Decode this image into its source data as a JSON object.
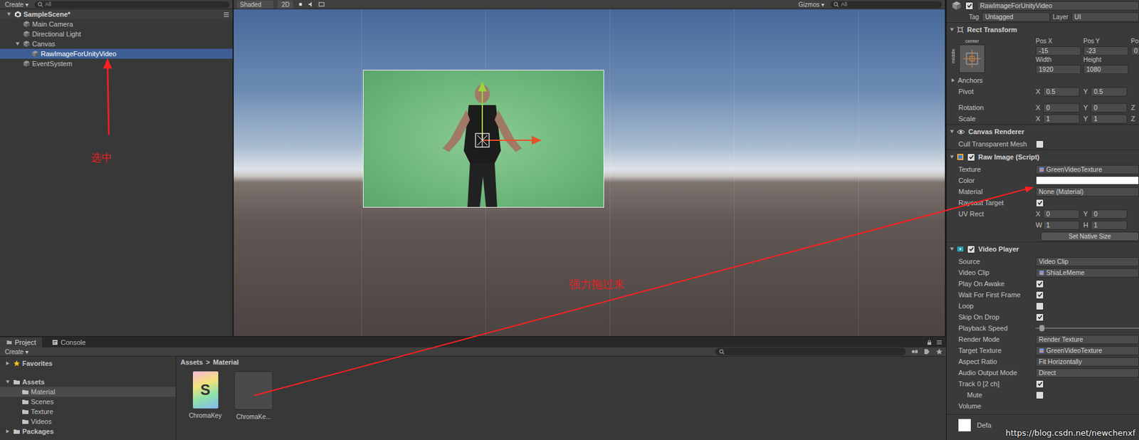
{
  "toolbars": {
    "hierarchy_create": "Create ▾",
    "hierarchy_search": "All",
    "scene_shading": "Shaded",
    "scene_mode": "2D",
    "gizmos": "Gizmos ▾",
    "scene_search": "All"
  },
  "hierarchy": {
    "scene": "SampleScene*",
    "scene_expanded": true,
    "items": [
      {
        "label": "Main Camera",
        "depth": 1,
        "has_children": false,
        "expanded": false,
        "selected": false
      },
      {
        "label": "Directional Light",
        "depth": 1,
        "has_children": false,
        "expanded": false,
        "selected": false
      },
      {
        "label": "Canvas",
        "depth": 1,
        "has_children": true,
        "expanded": true,
        "selected": false
      },
      {
        "label": "RawImageForUnityVideo",
        "depth": 2,
        "has_children": false,
        "expanded": false,
        "selected": true
      },
      {
        "label": "EventSystem",
        "depth": 1,
        "has_children": false,
        "expanded": false,
        "selected": false
      }
    ]
  },
  "inspector": {
    "object_name": "RawImageForUnityVideo",
    "active": true,
    "tag_label": "Tag",
    "tag": "Untagged",
    "layer_label": "Layer",
    "layer": "UI",
    "rect_transform": {
      "title": "Rect Transform",
      "expanded": true,
      "anchor_h": "center",
      "anchor_v": "middle",
      "pos_labels": [
        "Pos X",
        "Pos Y",
        "Po"
      ],
      "pos_values": [
        "-15",
        "-23",
        "0"
      ],
      "size_labels": [
        "Width",
        "Height"
      ],
      "size_values": [
        "1920",
        "1080"
      ],
      "anchors_label": "Anchors",
      "anchors_expanded": false,
      "vectors": [
        {
          "label": "Pivot",
          "fields": [
            {
              "axis": "X",
              "value": "0.5"
            },
            {
              "axis": "Y",
              "value": "0.5"
            }
          ]
        },
        {
          "label": "Rotation",
          "fields": [
            {
              "axis": "X",
              "value": "0"
            },
            {
              "axis": "Y",
              "value": "0"
            },
            {
              "axis": "Z",
              "value": ""
            }
          ]
        },
        {
          "label": "Scale",
          "fields": [
            {
              "axis": "X",
              "value": "1"
            },
            {
              "axis": "Y",
              "value": "1"
            },
            {
              "axis": "Z",
              "value": ""
            }
          ]
        }
      ]
    },
    "components": [
      {
        "title": "Canvas Renderer",
        "kind": "plain",
        "expanded": true,
        "enabled": true,
        "rows": [
          {
            "kind": "check",
            "label": "Cull Transparent Mesh",
            "checked": false
          }
        ]
      },
      {
        "title": "Raw Image (Script)",
        "kind": "toggle",
        "expanded": true,
        "enabled": true,
        "rows": [
          {
            "kind": "object",
            "label": "Texture",
            "value": "GreenVideoTexture"
          },
          {
            "kind": "color",
            "label": "Color",
            "color": "#ffffff"
          },
          {
            "kind": "text",
            "label": "Material",
            "value": "None (Material)"
          },
          {
            "kind": "check",
            "label": "Raycast Target",
            "checked": true
          },
          {
            "kind": "vector",
            "label": "UV Rect",
            "fields": [
              {
                "axis": "X",
                "value": "0"
              },
              {
                "axis": "Y",
                "value": "0"
              }
            ]
          },
          {
            "kind": "vector",
            "label": "",
            "fields": [
              {
                "axis": "W",
                "value": "1"
              },
              {
                "axis": "H",
                "value": "1"
              }
            ]
          },
          {
            "kind": "button",
            "label": "Set Native Size"
          }
        ]
      },
      {
        "title": "Video Player",
        "kind": "toggle",
        "expanded": true,
        "enabled": true,
        "rows": [
          {
            "kind": "dropdown",
            "label": "Source",
            "value": "Video Clip"
          },
          {
            "kind": "object",
            "label": "Video Clip",
            "value": "ShiaLeMeme"
          },
          {
            "kind": "check",
            "label": "Play On Awake",
            "checked": true
          },
          {
            "kind": "check",
            "label": "Wait For First Frame",
            "checked": true
          },
          {
            "kind": "check",
            "label": "Loop",
            "checked": false
          },
          {
            "kind": "check",
            "label": "Skip On Drop",
            "checked": true
          },
          {
            "kind": "slider",
            "label": "Playback Speed",
            "level": 0.06
          },
          {
            "kind": "dropdown",
            "label": "Render Mode",
            "value": "Render Texture"
          },
          {
            "kind": "object",
            "label": "Target Texture",
            "value": "GreenVideoTexture"
          },
          {
            "kind": "dropdown",
            "label": "Aspect Ratio",
            "value": "Fit Horizontally"
          },
          {
            "kind": "dropdown",
            "label": "Audio Output Mode",
            "value": "Direct"
          },
          {
            "kind": "check",
            "label": "Track 0 [2 ch]",
            "checked": true
          },
          {
            "kind": "check",
            "label": "Mute",
            "checked": false,
            "indented": true
          },
          {
            "kind": "label",
            "label": "Volume"
          }
        ]
      }
    ],
    "material_preview": {
      "label": "Defa"
    }
  },
  "project": {
    "tabs": [
      {
        "label": "Project",
        "selected": true
      },
      {
        "label": "Console",
        "selected": false
      }
    ],
    "create": "Create ▾",
    "tree": [
      {
        "label": "Favorites",
        "kind": "favorites",
        "depth": 0,
        "has_children": true,
        "expanded": false,
        "selected": false
      },
      {
        "label": "Assets",
        "kind": "folder",
        "depth": 0,
        "has_children": true,
        "expanded": true,
        "selected": false
      },
      {
        "label": "Material",
        "kind": "folder",
        "depth": 1,
        "has_children": false,
        "expanded": false,
        "selected": true
      },
      {
        "label": "Scenes",
        "kind": "folder",
        "depth": 1,
        "has_children": false,
        "expanded": false,
        "selected": false
      },
      {
        "label": "Texture",
        "kind": "folder",
        "depth": 1,
        "has_children": false,
        "expanded": false,
        "selected": false
      },
      {
        "label": "Videos",
        "kind": "folder",
        "depth": 1,
        "has_children": false,
        "expanded": false,
        "selected": false
      },
      {
        "label": "Packages",
        "kind": "folder",
        "depth": 0,
        "has_children": true,
        "expanded": false,
        "selected": false
      }
    ],
    "breadcrumb": [
      "Assets",
      "Material"
    ],
    "breadcrumb_separator": ">",
    "assets": [
      {
        "label": "ChromaKey",
        "kind": "shader",
        "glyph": "S",
        "selected": false
      },
      {
        "label": "ChromaKe...",
        "kind": "material",
        "selected": false
      }
    ]
  },
  "annotations": {
    "labels": [
      "选中",
      "强力拖过来"
    ]
  },
  "watermark": "https://blog.csdn.net/newchenxf"
}
